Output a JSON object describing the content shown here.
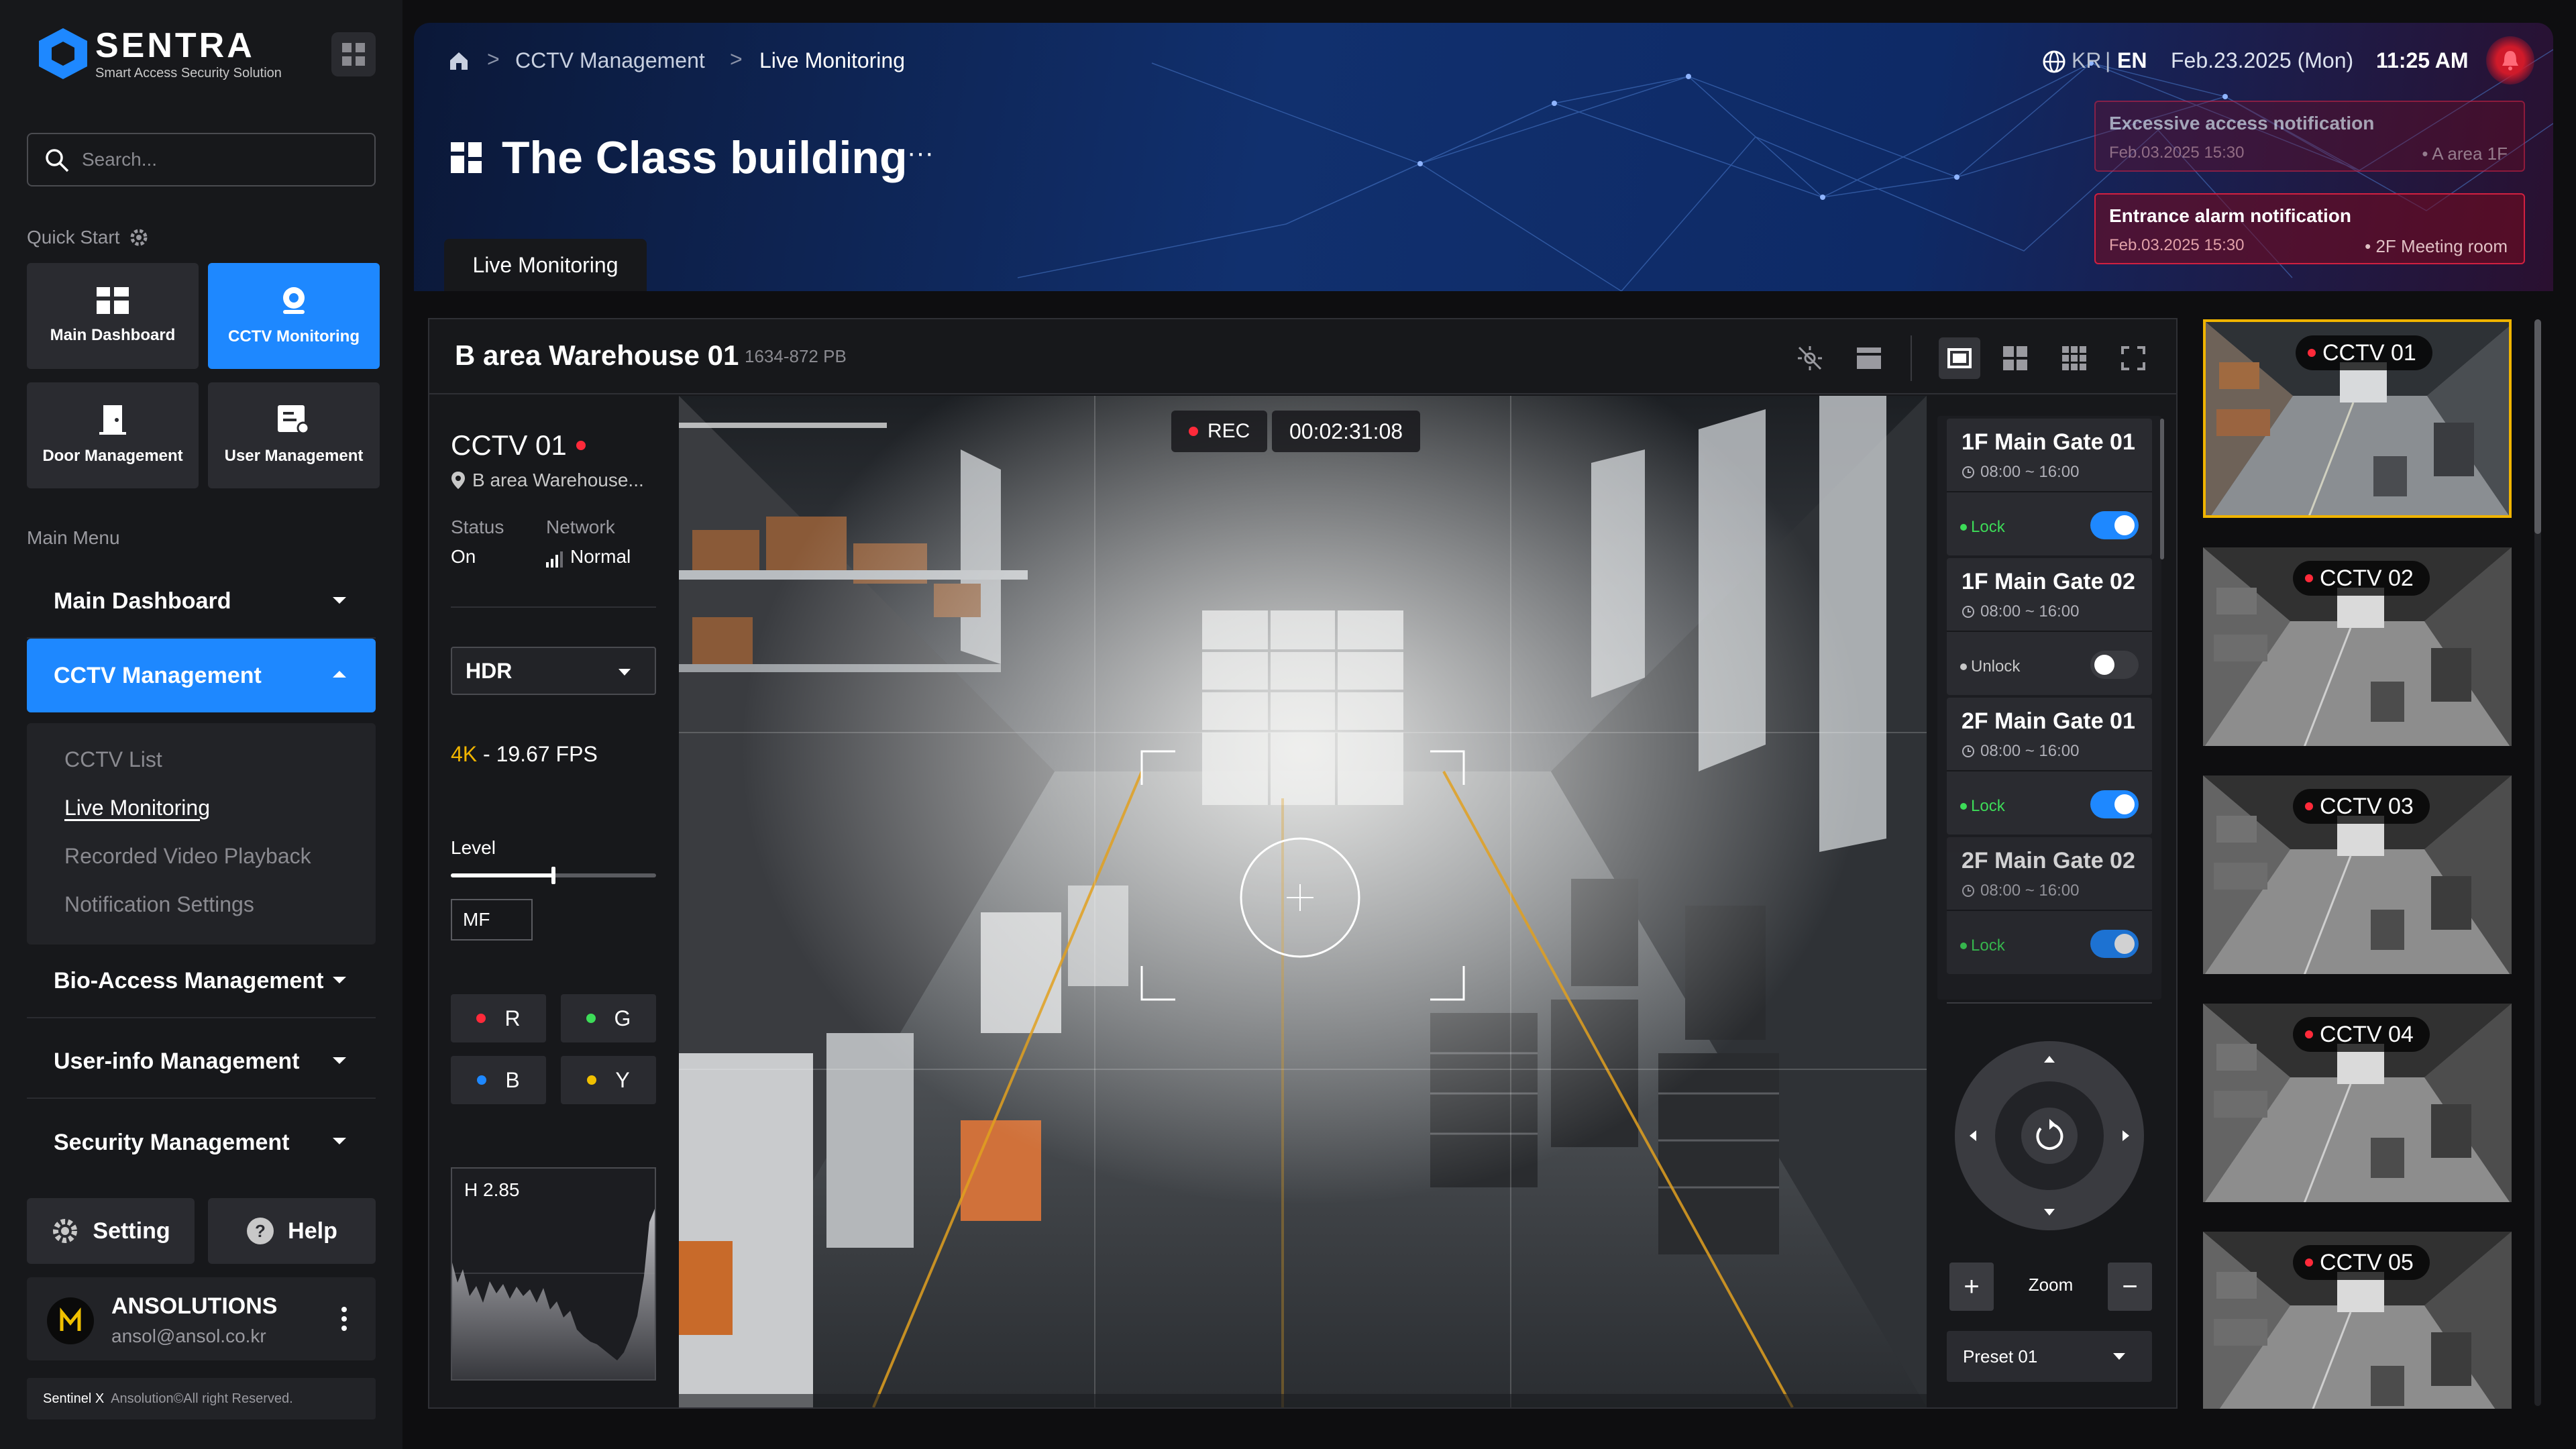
{
  "brand": {
    "name": "SENTRA",
    "tagline": "Smart Access Security Solution"
  },
  "search": {
    "placeholder": "Search..."
  },
  "quick_start": {
    "label": "Quick Start",
    "items": [
      {
        "label": "Main Dashboard",
        "icon": "dashboard-icon",
        "active": false
      },
      {
        "label": "CCTV Monitoring",
        "icon": "webcam-icon",
        "active": true
      },
      {
        "label": "Door Management",
        "icon": "door-icon",
        "active": false
      },
      {
        "label": "User Management",
        "icon": "user-list-icon",
        "active": false
      }
    ]
  },
  "main_menu": {
    "label": "Main Menu",
    "items": [
      {
        "label": "Main Dashboard"
      },
      {
        "label": "CCTV Management",
        "active": true
      },
      {
        "label": "Bio-Access Management"
      },
      {
        "label": "User-info Management"
      },
      {
        "label": "Security Management"
      }
    ],
    "submenu": [
      "CCTV List",
      "Live Monitoring",
      "Recorded Video Playback",
      "Notification Settings"
    ]
  },
  "footer": {
    "setting": "Setting",
    "help": "Help",
    "user_name": "ANSOLUTIONS",
    "user_email": "ansol@ansol.co.kr",
    "copyright_brand": "Sentinel X",
    "copyright": "Ansolution©All right Reserved."
  },
  "header": {
    "breadcrumb": [
      "CCTV Management",
      "Live Monitoring"
    ],
    "lang_kr": "KR",
    "lang_sep": "|",
    "lang_en": "EN",
    "date": "Feb.23.2025 (Mon)",
    "time": "11:25 AM",
    "title": "The Class building",
    "tab": "Live Monitoring",
    "notifications": [
      {
        "title": "Excessive access notification",
        "date": "Feb.03.2025 15:30",
        "location": "• A area 1F"
      },
      {
        "title": "Entrance alarm notification",
        "date": "Feb.03.2025 15:30",
        "location": "• 2F Meeting room"
      }
    ]
  },
  "camera": {
    "title": "B area Warehouse 01",
    "code": "1634-872 PB",
    "name": "CCTV 01",
    "location": "B area Warehouse...",
    "status_label": "Status",
    "status": "On",
    "network_label": "Network",
    "network": "Normal",
    "mode": "HDR",
    "resolution": "4K",
    "fps": "- 19.67 FPS",
    "level_label": "Level",
    "level": 0.5,
    "focus": "MF",
    "colors": [
      "R",
      "G",
      "B",
      "Y"
    ],
    "histogram_label": "H 2.85",
    "rec": "REC",
    "rec_time": "00:02:31:08"
  },
  "gates": [
    {
      "name": "1F Main Gate 01",
      "time": "08:00 ~ 16:00",
      "state": "Lock",
      "on": true
    },
    {
      "name": "1F Main Gate 02",
      "time": "08:00 ~ 16:00",
      "state": "Unlock",
      "on": false
    },
    {
      "name": "2F Main Gate 01",
      "time": "08:00 ~ 16:00",
      "state": "Lock",
      "on": true
    },
    {
      "name": "2F Main Gate 02",
      "time": "08:00 ~ 16:00",
      "state": "Lock",
      "on": true
    }
  ],
  "ptz": {
    "zoom_label": "Zoom",
    "zoom_in": "+",
    "zoom_out": "−",
    "preset": "Preset 01"
  },
  "thumbnails": [
    "CCTV 01",
    "CCTV 02",
    "CCTV 03",
    "CCTV 04",
    "CCTV 05"
  ],
  "colors": {
    "accent": "#1e88ff",
    "alert": "#d02040",
    "selected": "#f0b400",
    "lock": "#3ddc58"
  }
}
